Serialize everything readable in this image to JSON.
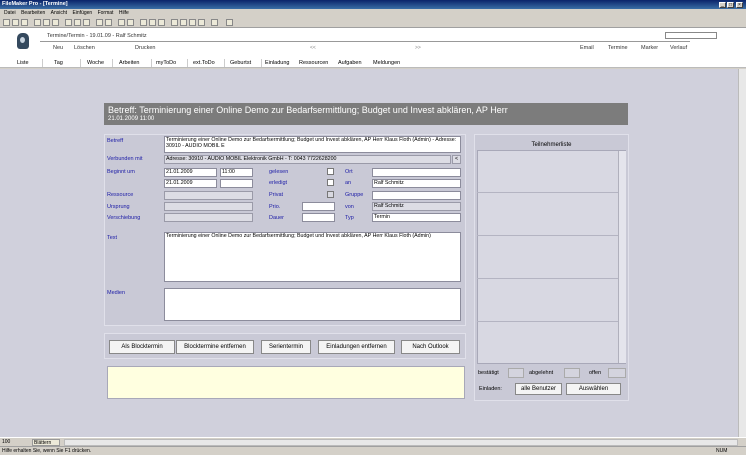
{
  "window": {
    "title": "FileMaker Pro - [Termine]"
  },
  "menu": [
    "Datei",
    "Bearbeiten",
    "Ansicht",
    "Einfügen",
    "Format",
    "Hilfe"
  ],
  "header": {
    "record_title": "Termine/Termin - 19.01.09 - Ralf Schmitz",
    "actions": [
      "Neu",
      "Löschen",
      "Drucken"
    ],
    "prev_arrow": "<<",
    "next_arrow": ">>",
    "right_links": [
      "Email",
      "Termine",
      "Marker",
      "Verlauf"
    ]
  },
  "nav": [
    "Liste",
    "Tag",
    "Woche",
    "Arbeiten",
    "myToDo",
    "ext.ToDo",
    "Geburtst",
    "Einladung",
    "Ressourcen",
    "Aufgaben",
    "Meldungen"
  ],
  "banner": {
    "title": "Betreff:   Terminierung einer Online Demo zur Bedarfsermittlung; Budget und Invest abklären, AP Herr",
    "date": "21.01.2009 11:00"
  },
  "form": {
    "betreff_label": "Betreff",
    "betreff_value": "Terminierung einer Online Demo zur Bedarfsermittlung; Budget und Invest abklären, AP Herr Klaus Floth (Admin) - Adresse: 30910 - AUDIO MOBIL E",
    "verbunden_label": "Verbunden mit",
    "verbunden_value": "Adresse: 30910 - AUDIO MOBIL Elektronik GmbH  - T: 0043 7722628200",
    "verbunden_btn": "<",
    "beginnt_label": "Beginnt um",
    "beginnt_date": "21.01.2009",
    "beginnt_time": "11:00",
    "end_date": "21.01.2009",
    "end_time": "",
    "gelesen_label": "gelesen",
    "erledigt_label": "erledigt",
    "privat_label": "Privat",
    "prio_label": "Prio.",
    "dauer_label": "Dauer",
    "ort_label": "Ort",
    "ort_value": "",
    "an_label": "an",
    "an_value": "Ralf Schmitz",
    "gruppe_label": "Gruppe",
    "gruppe_value": "",
    "von_label": "von",
    "von_value": "Ralf Schmitz",
    "typ_label": "Typ",
    "typ_value": "Termin",
    "ressource_label": "Ressource",
    "ursprung_label": "Ursprung",
    "verschiebung_label": "Verschiebung",
    "text_label": "Text",
    "text_value": "Terminierung einer Online Demo zur Bedarfsermittlung; Budget und Invest abklären, AP Herr Klaus Floth (Admin)",
    "medien_label": "Medien"
  },
  "buttons": [
    "Als Blocktermin",
    "Blocktermine entfernen",
    "Serientermin",
    "Einladungen entfernen",
    "Nach Outlook"
  ],
  "participants": {
    "title": "Teilnehmerliste",
    "bestaetigt_label": "bestätigt",
    "abgelehnt_label": "abgelehnt",
    "offen_label": "offen",
    "einladen_label": "Einladen:",
    "all_users_btn": "alle Benutzer",
    "select_btn": "Auswählen"
  },
  "status": {
    "zoom": "100",
    "mode": "Blättern",
    "help": "Hilfe erhalten Sie, wenn Sie F1 drücken.",
    "num": "NUM"
  }
}
